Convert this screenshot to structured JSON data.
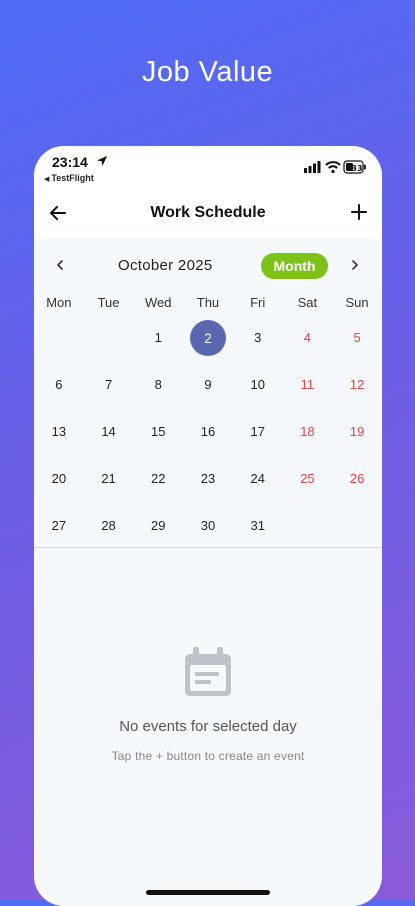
{
  "promo": {
    "headline": "Job Value"
  },
  "status_bar": {
    "time": "23:14",
    "back_app": "TestFlight",
    "battery": "33"
  },
  "app_bar": {
    "title": "Work Schedule",
    "back_icon": "arrow-left-icon",
    "add_icon": "plus-icon"
  },
  "calendar": {
    "month_label": "October 2025",
    "view_button": "Month",
    "selected_day": "2",
    "weekdays": [
      "Mon",
      "Tue",
      "Wed",
      "Thu",
      "Fri",
      "Sat",
      "Sun"
    ],
    "days": [
      "1",
      "2",
      "3",
      "4",
      "5",
      "6",
      "7",
      "8",
      "9",
      "10",
      "11",
      "12",
      "13",
      "14",
      "15",
      "16",
      "17",
      "18",
      "19",
      "20",
      "21",
      "22",
      "23",
      "24",
      "25",
      "26",
      "27",
      "28",
      "29",
      "30",
      "31"
    ]
  },
  "empty_state": {
    "icon": "calendar-icon",
    "title": "No events for selected day",
    "hint": "Tap the + button to create an event"
  },
  "colors": {
    "accent_green": "#7cc218",
    "selected_day": "#5867b0",
    "weekend_red": "#e04444",
    "gradient_start": "#4f6cf6",
    "gradient_end": "#8a5bd9"
  }
}
